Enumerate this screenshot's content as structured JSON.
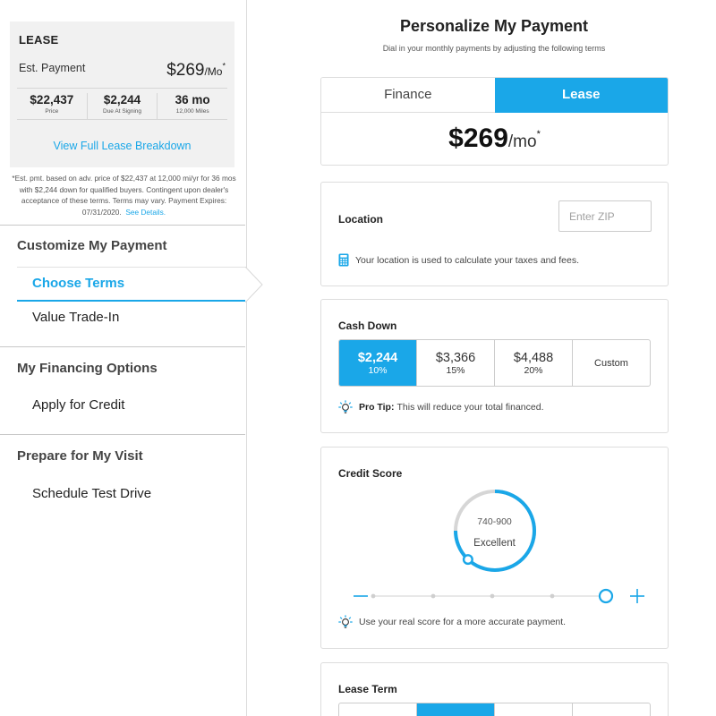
{
  "colors": {
    "accent": "#1aa7e8",
    "text": "#222222",
    "muted": "#555555",
    "card_bg": "#f1f1f1"
  },
  "sidebar": {
    "lease_card": {
      "title": "LEASE",
      "est_label": "Est. Payment",
      "est_value": "$269",
      "est_unit": "/Mo",
      "est_mark": "*",
      "stats": [
        {
          "value": "$22,437",
          "label": "Price"
        },
        {
          "value": "$2,244",
          "label": "Due At Signing"
        },
        {
          "value": "36 mo",
          "label": "12,000 Miles"
        }
      ],
      "breakdown_link": "View Full Lease Breakdown"
    },
    "disclaimer": "*Est. pmt. based on adv. price of $22,437 at 12,000 mi/yr for 36 mos with $2,244 down for qualified buyers. Contingent upon dealer's acceptance of these terms. Terms may vary. Payment Expires: 07/31/2020.",
    "see_details": "See Details.",
    "sections": [
      {
        "heading": "Customize My Payment",
        "items": [
          "Choose Terms",
          "Value Trade-In"
        ]
      },
      {
        "heading": "My Financing Options",
        "items": [
          "Apply for Credit"
        ]
      },
      {
        "heading": "Prepare for My Visit",
        "items": [
          "Schedule Test Drive"
        ]
      }
    ]
  },
  "main": {
    "title": "Personalize My Payment",
    "subtitle": "Dial in your monthly payments by adjusting the following terms",
    "tabs": {
      "finance": "Finance",
      "lease": "Lease",
      "selected": "Lease"
    },
    "payment": {
      "value": "$269",
      "unit": "/mo",
      "mark": "*"
    },
    "location": {
      "title": "Location",
      "zip_placeholder": "Enter ZIP",
      "zip_value": "",
      "note": "Your location is used to calculate your taxes and fees.",
      "icon": "calculator-icon"
    },
    "cash_down": {
      "title": "Cash Down",
      "options": [
        {
          "amount": "$2,244",
          "percent": "10%",
          "selected": true
        },
        {
          "amount": "$3,366",
          "percent": "15%",
          "selected": false
        },
        {
          "amount": "$4,488",
          "percent": "20%",
          "selected": false
        }
      ],
      "custom_label": "Custom",
      "tip_label": "Pro Tip:",
      "tip_text": "This will reduce your total financed."
    },
    "credit_score": {
      "title": "Credit Score",
      "range": "740-900",
      "label": "Excellent",
      "level": 0.75,
      "slider_position": "5 of 5",
      "note": "Use your real score for a more accurate payment."
    },
    "lease_term": {
      "title": "Lease Term",
      "selected_index": 1
    }
  }
}
